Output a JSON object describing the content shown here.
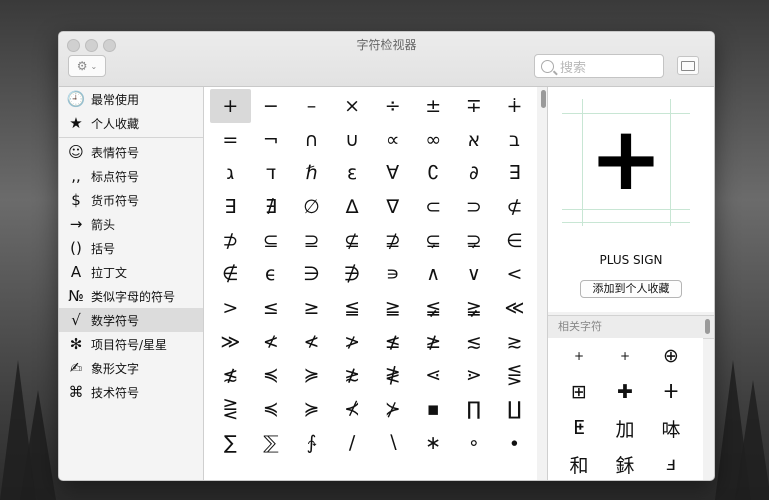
{
  "window": {
    "title": "字符检视器"
  },
  "toolbar": {
    "search_placeholder": "搜索"
  },
  "sidebar": {
    "items": [
      {
        "icon": "clock-icon",
        "glyph": "🕘",
        "label": "最常使用"
      },
      {
        "icon": "star-icon",
        "glyph": "★",
        "label": "个人收藏"
      },
      {
        "icon": "smiley-icon",
        "glyph": "☺",
        "label": "表情符号"
      },
      {
        "icon": "punctuation-icon",
        "glyph": ",,",
        "label": "标点符号"
      },
      {
        "icon": "dollar-icon",
        "glyph": "$",
        "label": "货币符号"
      },
      {
        "icon": "arrow-icon",
        "glyph": "→",
        "label": "箭头"
      },
      {
        "icon": "parentheses-icon",
        "glyph": "()",
        "label": "括号"
      },
      {
        "icon": "latin-a-icon",
        "glyph": "A",
        "label": "拉丁文"
      },
      {
        "icon": "numero-icon",
        "glyph": "№",
        "label": "类似字母的符号"
      },
      {
        "icon": "sqrt-icon",
        "glyph": "√",
        "label": "数学符号"
      },
      {
        "icon": "asterisk-icon",
        "glyph": "✻",
        "label": "项目符号/星星"
      },
      {
        "icon": "writing-hand-icon",
        "glyph": "✍",
        "label": "象形文字"
      },
      {
        "icon": "command-icon",
        "glyph": "⌘",
        "label": "技术符号"
      }
    ]
  },
  "grid": {
    "chars": [
      "+",
      "−",
      "–",
      "×",
      "÷",
      "±",
      "∓",
      "∔",
      "=",
      "¬",
      "∩",
      "∪",
      "∝",
      "∞",
      "א",
      "ב",
      "ג",
      "ד",
      "ℏ",
      "ε",
      "∀",
      "∁",
      "∂",
      "∃",
      "∃",
      "∄",
      "∅",
      "∆",
      "∇",
      "⊂",
      "⊃",
      "⊄",
      "⊅",
      "⊆",
      "⊇",
      "⊈",
      "⊉",
      "⊊",
      "⊋",
      "∈",
      "∉",
      "ϵ",
      "∋",
      "∌",
      "∍",
      "∧",
      "∨",
      "<",
      ">",
      "≤",
      "≥",
      "≦",
      "≧",
      "≨",
      "≩",
      "≪",
      "≫",
      "≮",
      "≮",
      "≯",
      "≰",
      "≱",
      "≲",
      "≳",
      "≴",
      "≼",
      "≽",
      "≵",
      "≹",
      "⋖",
      "⋗",
      "⋚",
      "⋛",
      "≼",
      "≽",
      "⊀",
      "⊁",
      "▪",
      "∏",
      "∐",
      "∑",
      "⅀",
      "∱",
      "∕",
      "∖",
      "∗",
      "∘",
      "∙"
    ],
    "selected_char": "+"
  },
  "detail": {
    "char": "+",
    "name": "PLUS SIGN",
    "favorite_button": "添加到个人收藏"
  },
  "related": {
    "heading": "相关字符",
    "chars": [
      "+",
      "+",
      "⊕",
      "⊞",
      "✚",
      "ⵜ",
      "ⵟ",
      "加",
      "呠",
      "和",
      "鉌",
      "ⅎ"
    ]
  }
}
